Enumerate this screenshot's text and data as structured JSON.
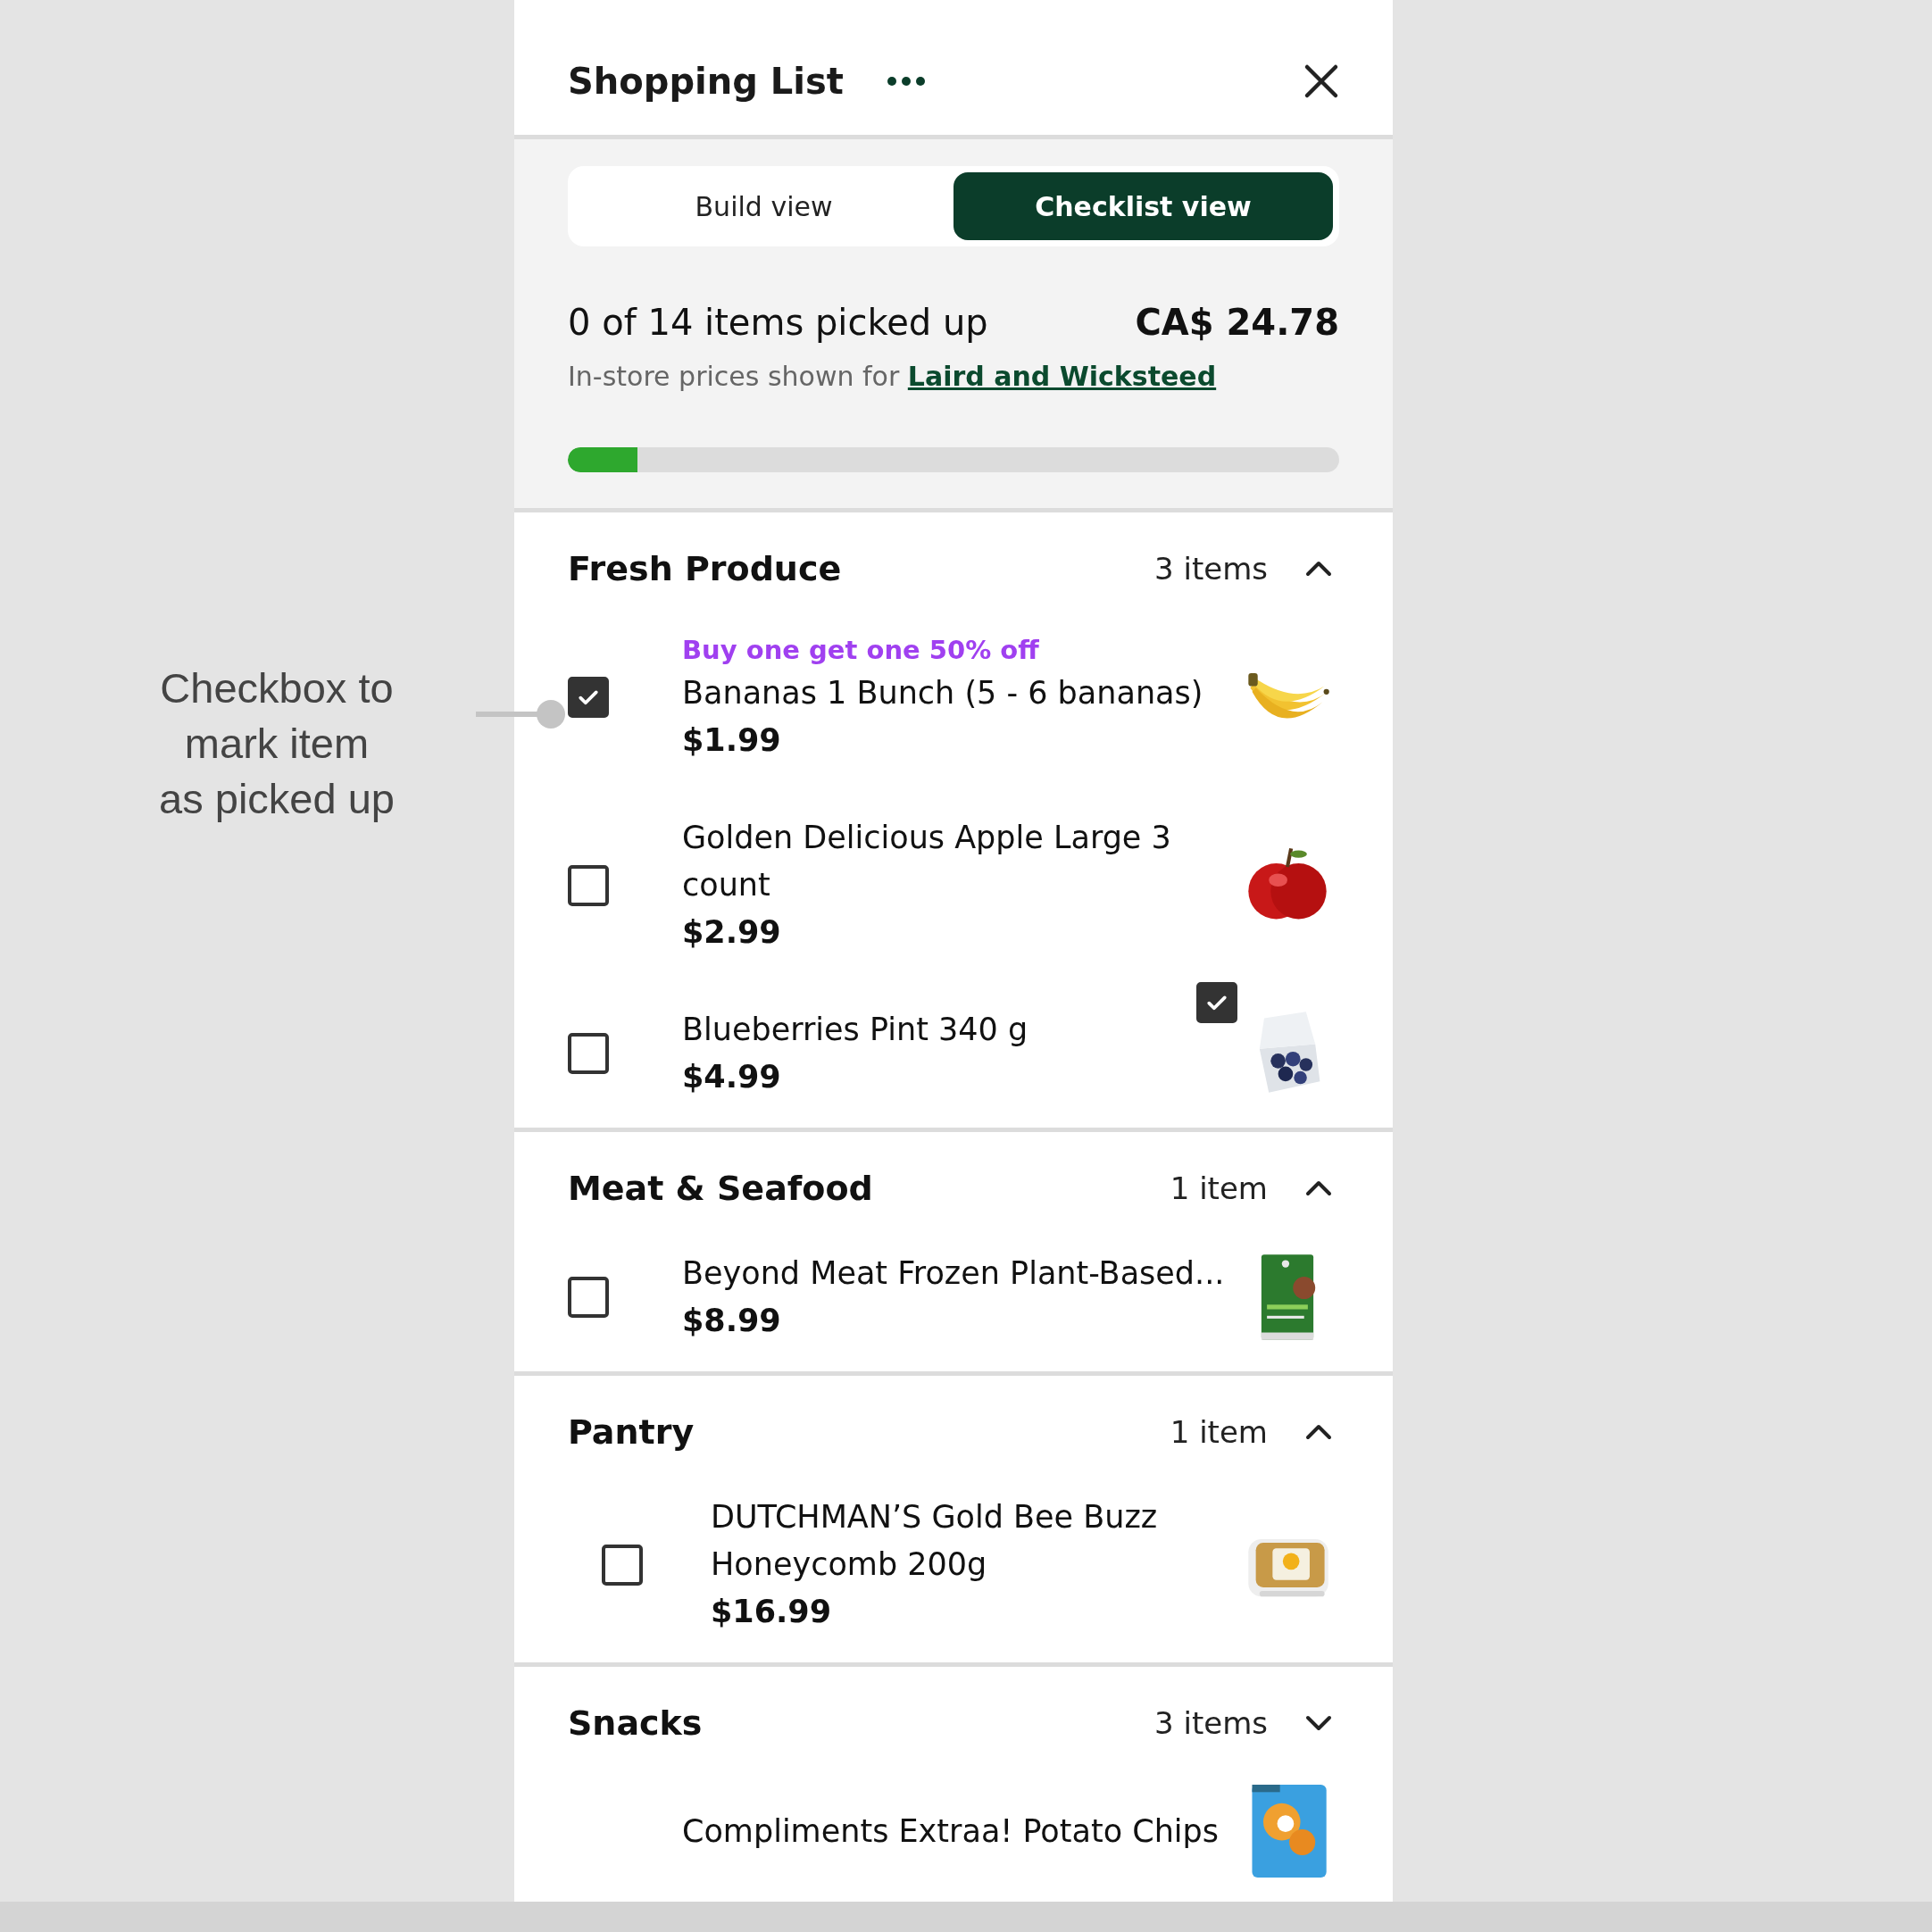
{
  "annotation": {
    "lines": [
      "Checkbox to",
      "mark item",
      "as picked up"
    ]
  },
  "header": {
    "title": "Shopping List"
  },
  "view_tabs": [
    {
      "label": "Build view",
      "selected": false
    },
    {
      "label": "Checklist view",
      "selected": true
    }
  ],
  "summary": {
    "picked": "0 of 14 items picked up",
    "total": "CA$ 24.78",
    "store_note": "In-store prices shown for",
    "store_link": "Laird and Wicksteed",
    "progress": {
      "level": 0.09
    }
  },
  "sections": [
    {
      "name": "Fresh Produce",
      "count": "3 items",
      "expanded": true,
      "items": [
        {
          "promo": "Buy one get one 50% off",
          "name": "Bananas 1 Bunch (5 - 6 bananas)",
          "price": "$1.99",
          "checked": true,
          "indented": false
        },
        {
          "name": "Golden Delicious Apple Large 3 count",
          "price": "$2.99",
          "checked": false,
          "indented": false
        },
        {
          "name": "Blueberries Pint 340 g",
          "price": "$4.99",
          "checked": false,
          "indented": false
        }
      ]
    },
    {
      "name": "Meat & Seafood",
      "count": "1 item",
      "expanded": true,
      "items": [
        {
          "name": "Beyond Meat Frozen Plant-Based...",
          "price": "$8.99",
          "checked": false,
          "indented": false
        }
      ]
    },
    {
      "name": "Pantry",
      "count": "1 item",
      "expanded": true,
      "items": [
        {
          "name": "DUTCHMAN’S Gold Bee Buzz Honeycomb 200g",
          "price": "$16.99",
          "checked": false,
          "indented": true
        }
      ]
    },
    {
      "name": "Snacks",
      "count": "3 items",
      "expanded": false,
      "items": [
        {
          "name": "Compliments Extraa! Potato Chips",
          "indented": false
        }
      ]
    }
  ],
  "floating_checkbox": {
    "checked": true
  }
}
